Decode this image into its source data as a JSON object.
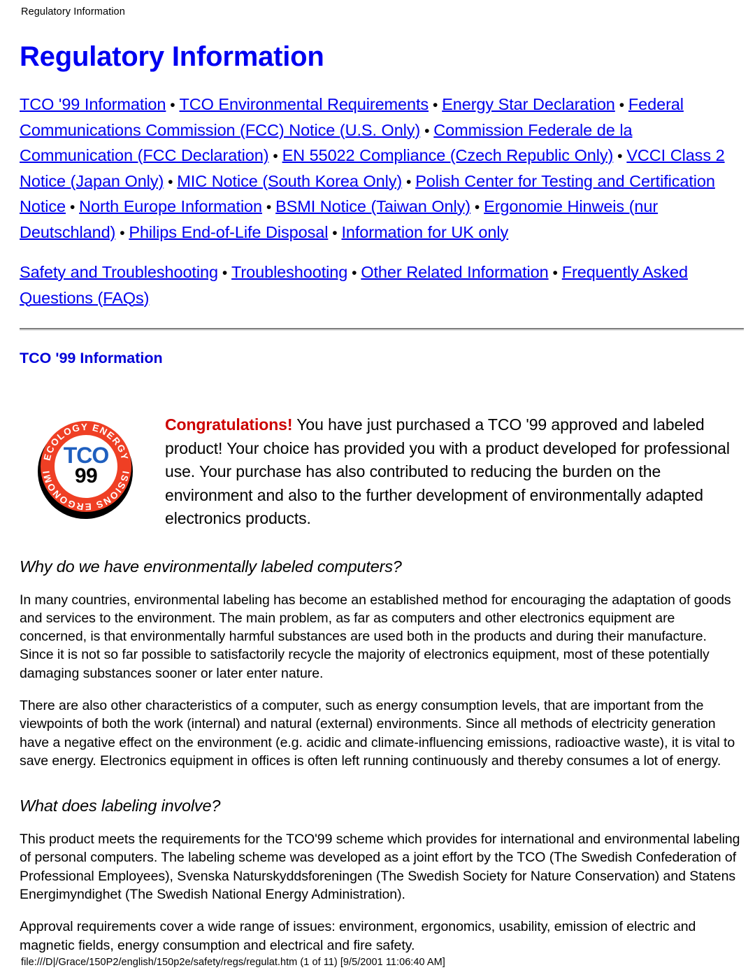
{
  "document": {
    "running_header": "Regulatory Information",
    "title": "Regulatory Information",
    "footer": "file:///D|/Grace/150P2/english/150p2e/safety/regs/regulat.htm (1 of 11) [9/5/2001 11:06:40 AM]"
  },
  "colors": {
    "link": "#0000ee",
    "title": "#0000f0",
    "section_title": "#0000d8",
    "highlight": "#cc0000",
    "logo_ring": "#ef3f24",
    "logo_tco": "#1f5fbf",
    "rule_dark": "#7d7d7d",
    "rule_light": "#e4e4e4"
  },
  "nav": {
    "separator": "•",
    "group1": [
      "TCO '99 Information",
      "TCO Environmental Requirements",
      "Energy Star Declaration",
      "Federal Communications Commission (FCC) Notice (U.S. Only)",
      "Commission Federale de la Communication (FCC Declaration)",
      "EN 55022 Compliance (Czech Republic Only)",
      "VCCI Class 2 Notice (Japan Only)",
      "MIC Notice (South Korea Only)",
      "Polish Center for Testing and Certification Notice",
      "North Europe Information",
      "BSMI Notice (Taiwan Only)",
      "Ergonomie Hinweis (nur Deutschland)",
      "Philips End-of-Life Disposal",
      "Information for UK only"
    ],
    "group2": [
      "Safety and Troubleshooting",
      "Troubleshooting",
      "Other Related Information",
      "Frequently Asked Questions (FAQs)"
    ]
  },
  "sections": {
    "tco99_heading": "TCO '99 Information",
    "congratulations_label": "Congratulations!",
    "congratulations_text": " You have just purchased a TCO '99 approved and labeled product! Your choice has provided you with a product developed for professional use. Your purchase has also contributed to reducing the burden on the environment and also to the further development of environmentally adapted electronics products.",
    "subhead_why": "Why do we have environmentally labeled computers?",
    "para_why_1": "In many countries, environmental labeling has become an established method for encouraging the adaptation of goods and services to the environment. The main problem, as far as computers and other electronics equipment are concerned, is that environmentally harmful substances are used both in the products and during their manufacture. Since it is not so far possible to satisfactorily recycle the majority of electronics equipment, most of these potentially damaging substances sooner or later enter nature.",
    "para_why_2": "There are also other characteristics of a computer, such as energy consumption levels, that are important from the viewpoints of both the work (internal) and natural (external) environments. Since all methods of electricity generation have a negative effect on the environment (e.g. acidic and climate-influencing emissions, radioactive waste), it is vital to save energy. Electronics equipment in offices is often left running continuously and thereby consumes a lot of energy.",
    "subhead_labeling": "What does labeling involve?",
    "para_labeling_1": "This product meets the requirements for the TCO'99 scheme which provides for international and environmental labeling of personal computers. The labeling scheme was developed as a joint effort by the TCO (The Swedish Confederation of Professional Employees), Svenska Naturskyddsforeningen (The Swedish Society for Nature Conservation) and Statens Energimyndighet (The Swedish National Energy Administration).",
    "para_labeling_2": "Approval requirements cover a wide range of issues: environment, ergonomics, usability, emission of electric and magnetic fields, energy consumption and electrical and fire safety."
  },
  "logo": {
    "name": "TCO '99 certification logo",
    "word": "TCO",
    "year": "99",
    "ring_top": "ECOLOGY  ENERGY",
    "ring_bottom": "EMISSIONS  ERGONOMICS",
    "ring_words": [
      "ECOLOGY",
      "ENERGY",
      "ERGONOMICS",
      "EMISSIONS"
    ]
  }
}
